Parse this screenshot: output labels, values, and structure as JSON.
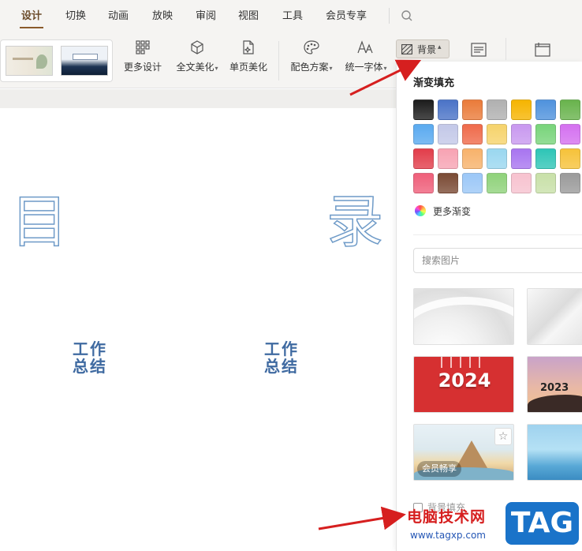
{
  "menu": {
    "items": [
      {
        "label": "设计",
        "active": true
      },
      {
        "label": "切换"
      },
      {
        "label": "动画"
      },
      {
        "label": "放映"
      },
      {
        "label": "审阅"
      },
      {
        "label": "视图"
      },
      {
        "label": "工具"
      },
      {
        "label": "会员专享"
      }
    ],
    "search_icon": "search-icon"
  },
  "toolbar": {
    "more_design": "更多设计",
    "full_beautify": "全文美化",
    "page_beautify": "单页美化",
    "color_scheme": "配色方案",
    "unify_font": "统一字体",
    "background": "背景"
  },
  "slide": {
    "char_left": "目",
    "char_right": "录",
    "work_title_1_line1": "工作",
    "work_title_1_line2": "总结",
    "work_title_2_line1": "工作",
    "work_title_2_line2": "总结"
  },
  "panel": {
    "gradient_title": "渐变填充",
    "more_gradient": "更多渐变",
    "search_placeholder": "搜索图片",
    "tile_2024": "2024",
    "tile_2023": "2023",
    "vip_badge": "会员畅享",
    "apply_label": "背景填充"
  },
  "swatches": [
    [
      "#1c1c1c",
      "#4a73c7",
      "#ea7b3a",
      "#b0b0b0",
      "#f6b400",
      "#4f92dd",
      "#68b34c",
      "#36b9c8"
    ],
    [
      "#5aaaf0",
      "#c3c8e8",
      "#ef6a4a",
      "#f6d36b",
      "#c898ef",
      "#78d47a",
      "#d470f0",
      "#7fd6e8"
    ],
    [
      "#e23d4a",
      "#f7a3b3",
      "#f7b26b",
      "#9ad7f0",
      "#a875f0",
      "#2ec5b6",
      "#f6c23a",
      "#5cc0ff"
    ],
    [
      "#ef5f7a",
      "#7a4a34",
      "#9bc7f7",
      "#8fd27a",
      "#f7c2cf",
      "#c8e0a8",
      "#9a9a9a",
      "#c4e8f0"
    ]
  ],
  "watermark": {
    "title": "电脑技术网",
    "url": "www.tagxp.com",
    "tag": "TAG"
  },
  "colors": {
    "accent": "#8a5a2b",
    "slide_text": "#3f6aa1",
    "arrow": "#d61f1f"
  }
}
